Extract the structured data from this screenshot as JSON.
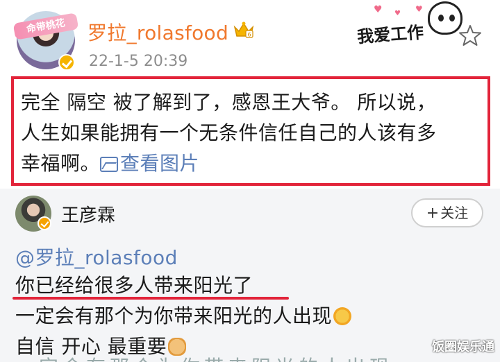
{
  "post": {
    "avatar_banner": "命带桃花",
    "username": "罗拉_rolasfood",
    "timestamp": "22-1-5 20:39",
    "sticker_text": "我爱工作",
    "text_line1": "完全 隔空 被了解到了，感恩王大爷。 所以说，",
    "text_line2": "人生如果能拥有一个无条件信任自己的人该有多",
    "text_line3": "幸福啊。",
    "view_image_label": "查看图片",
    "icons": [
      "crown-badge-icon",
      "star-icon",
      "picture-icon",
      "verified-badge-icon"
    ]
  },
  "comment": {
    "name": "王彦霖",
    "follow_label": "关注",
    "mention": "@罗拉_rolasfood",
    "line2": "你已经给很多人带来阳光了",
    "line3": "一定会有那个为你带来阳光的人出现",
    "line4": "自信 开心 最重要",
    "line5": "一定会有那个为你带来阳光的人出现"
  },
  "watermark": "饭圈娱乐通",
  "colors": {
    "username": "#f0782d",
    "link": "#5c7fb8",
    "highlight_border": "#e2243a",
    "verified_badge": "#f5b400"
  }
}
